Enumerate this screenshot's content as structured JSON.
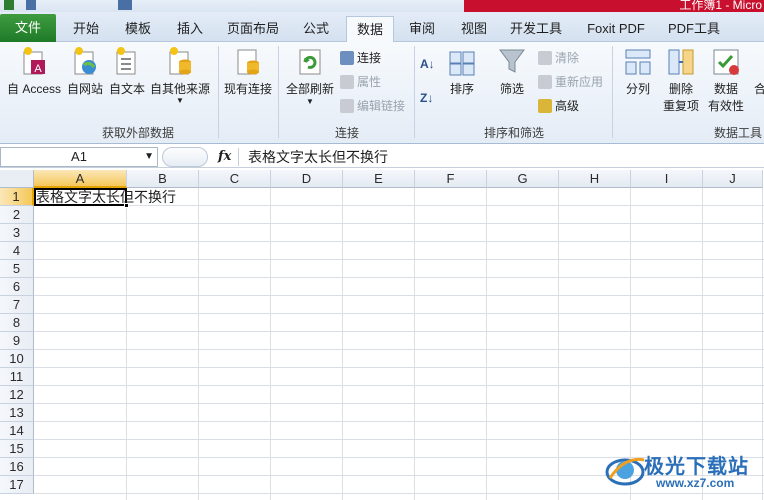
{
  "titlebar": {
    "title": "工作簿1 - Micro"
  },
  "tabs": [
    "文件",
    "开始",
    "模板",
    "插入",
    "页面布局",
    "公式",
    "数据",
    "审阅",
    "视图",
    "开发工具",
    "Foxit PDF",
    "PDF工具"
  ],
  "active_tab": "数据",
  "ribbon": {
    "external": {
      "label": "获取外部数据",
      "access": "自 Access",
      "web": "自网站",
      "text": "自文本",
      "other": "自其他来源",
      "existing": "现有连接"
    },
    "connections": {
      "label": "连接",
      "refresh_all": "全部刷新",
      "connections": "连接",
      "properties": "属性",
      "edit_links": "编辑链接"
    },
    "sort_filter": {
      "label": "排序和筛选",
      "sort": "排序",
      "filter": "筛选",
      "clear": "清除",
      "reapply": "重新应用",
      "advanced": "高级"
    },
    "data_tools": {
      "label": "数据工具",
      "text_to_columns": "分列",
      "remove_dup_1": "删除",
      "remove_dup_2": "重复项",
      "validation_1": "数据",
      "validation_2": "有效性",
      "consolidate": "合"
    }
  },
  "formula_bar": {
    "name_box": "A1",
    "fx": "fx",
    "content": "表格文字太长但不换行"
  },
  "sheet": {
    "columns": [
      "A",
      "B",
      "C",
      "D",
      "E",
      "F",
      "G",
      "H",
      "I",
      "J"
    ],
    "rows": [
      "1",
      "2",
      "3",
      "4",
      "5",
      "6",
      "7",
      "8",
      "9",
      "10",
      "11",
      "12",
      "13",
      "14",
      "15",
      "16",
      "17"
    ],
    "a1_part1": "表格文字太长",
    "a1_part2": "但不换行"
  },
  "watermark": {
    "title": "极光下载站",
    "url": "www.xz7.com"
  },
  "colors": {
    "file_tab": "#2a8a33",
    "title_red": "#c8102e",
    "selection_header": "#f5c85a"
  }
}
